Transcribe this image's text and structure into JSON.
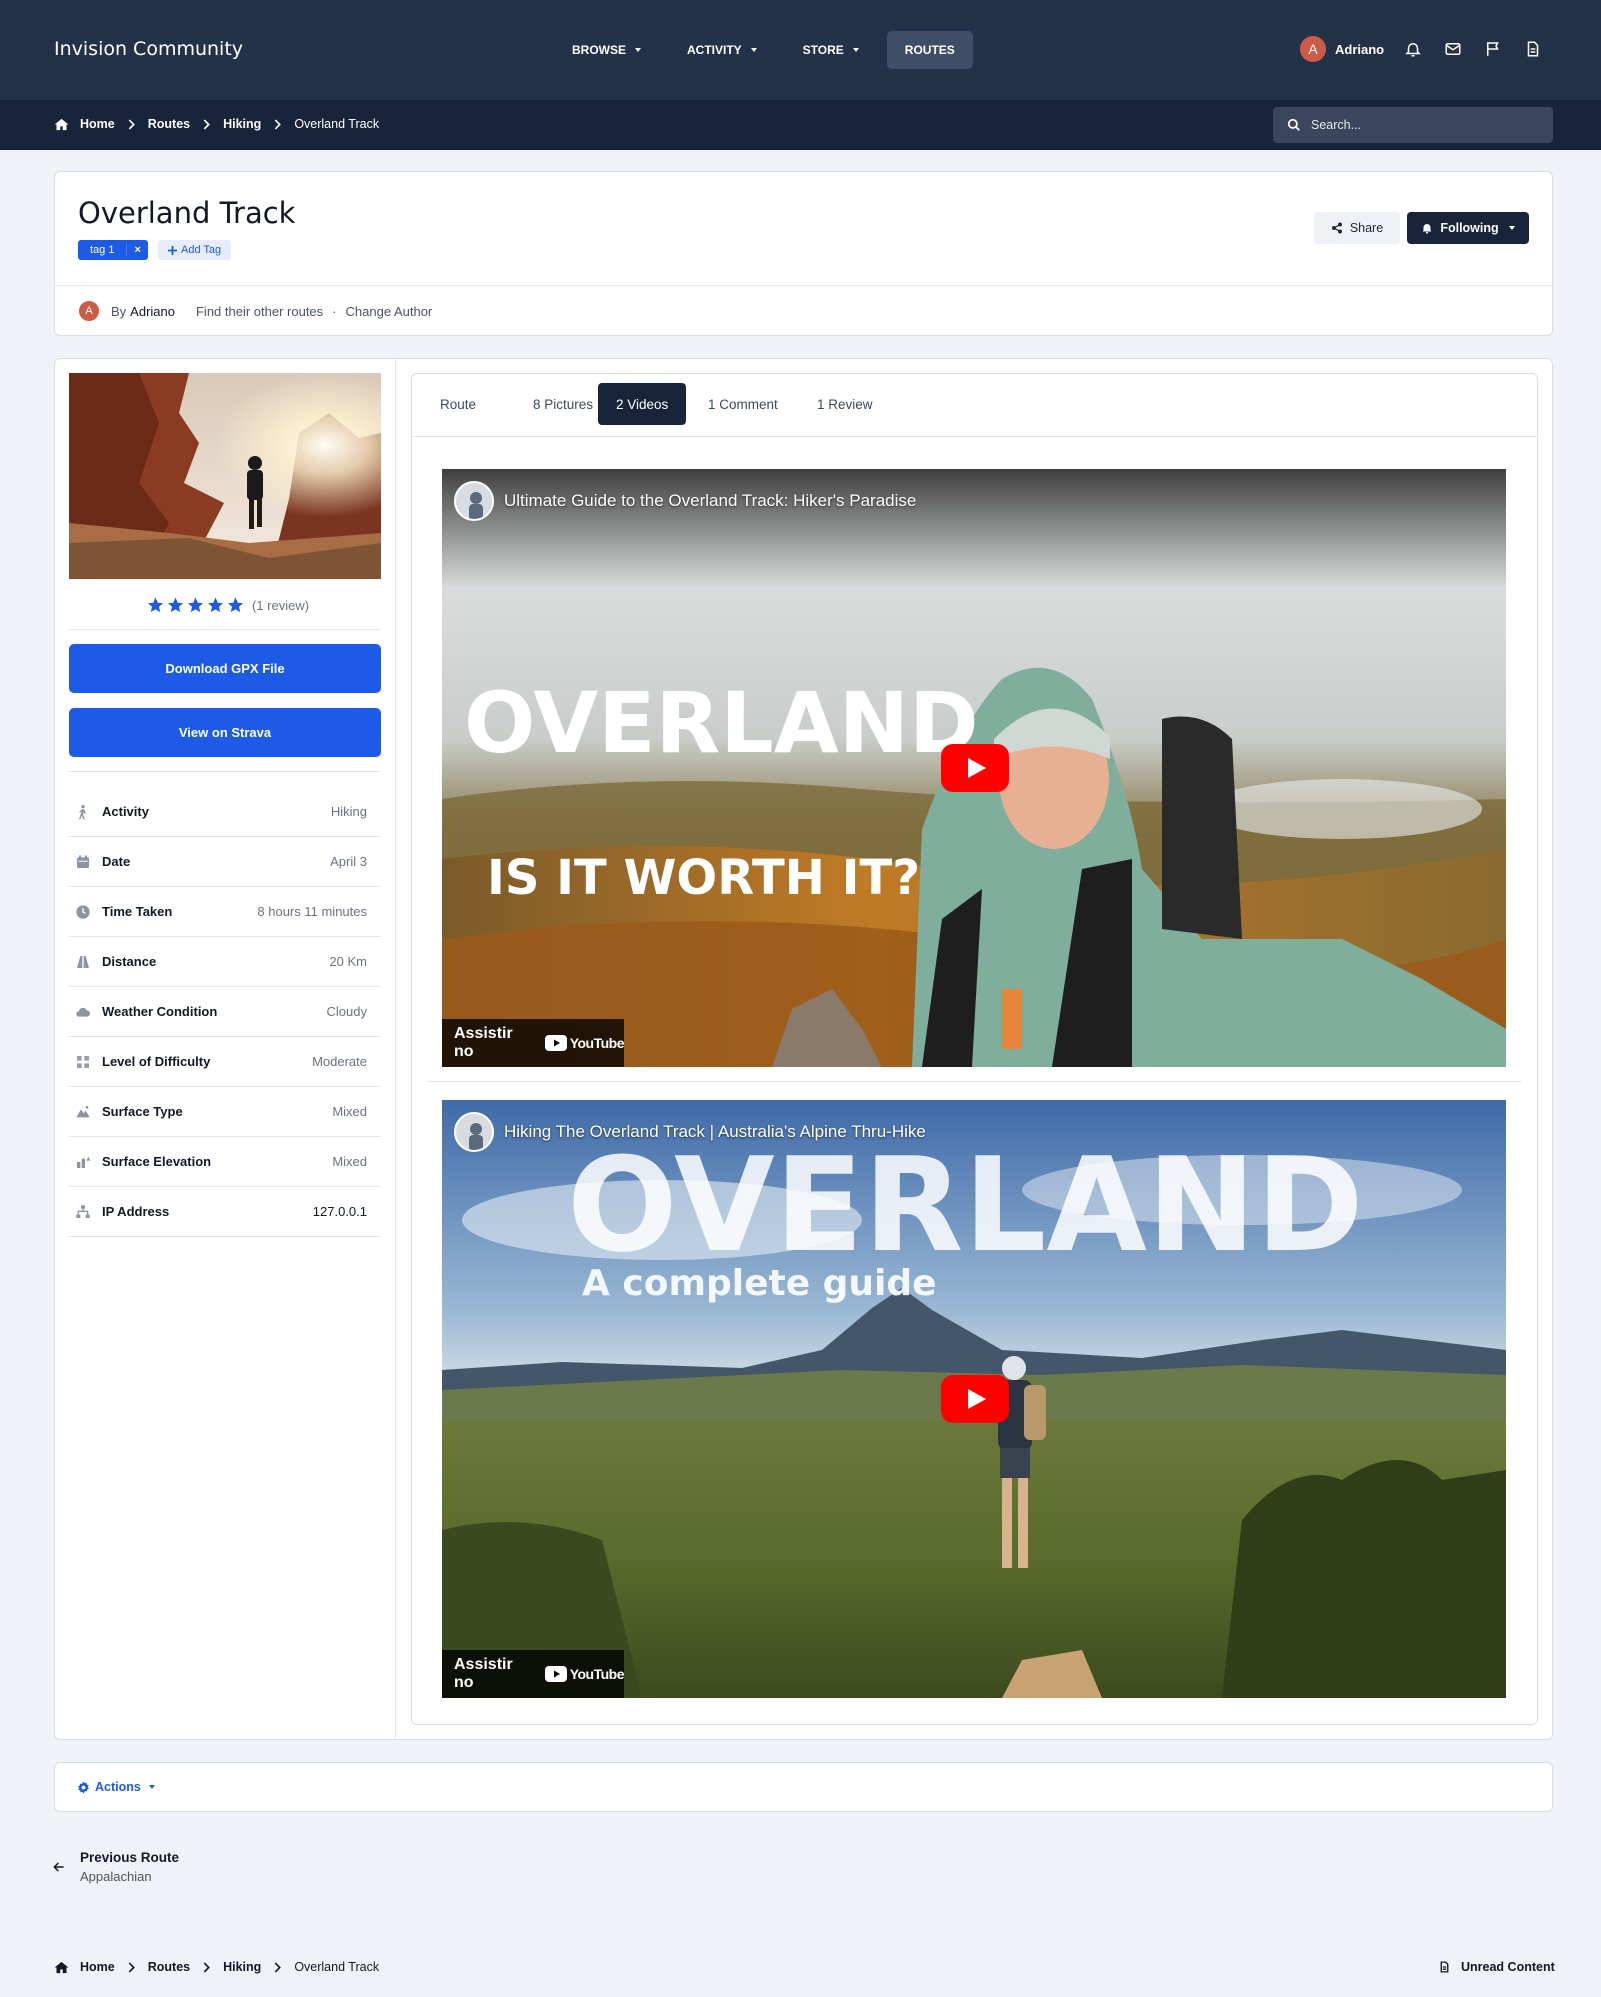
{
  "header": {
    "brand": "Invision Community",
    "nav": [
      {
        "label": "BROWSE",
        "dropdown": true
      },
      {
        "label": "ACTIVITY",
        "dropdown": true
      },
      {
        "label": "STORE",
        "dropdown": true
      },
      {
        "label": "ROUTES",
        "dropdown": false,
        "active": true
      }
    ],
    "user": {
      "initial": "A",
      "name": "Adriano"
    },
    "icons": [
      "bell-icon",
      "envelope-icon",
      "flag-icon",
      "document-icon"
    ]
  },
  "breadcrumb": {
    "items": [
      "Home",
      "Routes",
      "Hiking"
    ],
    "current": "Overland Track"
  },
  "search": {
    "placeholder": "Search..."
  },
  "page": {
    "title": "Overland Track",
    "tag": "tag 1",
    "tag_remove": "×",
    "add_tag": "Add Tag",
    "share": "Share",
    "following": "Following",
    "author_prefix": "By",
    "author": "Adriano",
    "author_initial": "A",
    "find_routes": "Find their other routes",
    "separator": "·",
    "change_author": "Change Author"
  },
  "sidebar": {
    "rating_stars": 5,
    "review_count": "(1 review)",
    "download_gpx": "Download GPX File",
    "view_strava": "View on Strava",
    "details": [
      {
        "icon": "hiker-icon",
        "label": "Activity",
        "value": "Hiking"
      },
      {
        "icon": "calendar-icon",
        "label": "Date",
        "value": "April 3"
      },
      {
        "icon": "clock-icon",
        "label": "Time Taken",
        "value": "8 hours 11 minutes"
      },
      {
        "icon": "road-icon",
        "label": "Distance",
        "value": "20 Km"
      },
      {
        "icon": "cloud-icon",
        "label": "Weather Condition",
        "value": "Cloudy"
      },
      {
        "icon": "difficulty-icon",
        "label": "Level of Difficulty",
        "value": "Moderate"
      },
      {
        "icon": "mountain-icon",
        "label": "Surface Type",
        "value": "Mixed"
      },
      {
        "icon": "elevation-icon",
        "label": "Surface Elevation",
        "value": "Mixed"
      },
      {
        "icon": "network-icon",
        "label": "IP Address",
        "value": "127.0.0.1"
      }
    ]
  },
  "tabs": [
    {
      "label": "Route",
      "active": false
    },
    {
      "label": "8 Pictures",
      "active": false
    },
    {
      "label": "2 Videos",
      "active": true
    },
    {
      "label": "1 Comment",
      "active": false
    },
    {
      "label": "1 Review",
      "active": false
    }
  ],
  "videos": [
    {
      "title": "Ultimate Guide to the Overland Track: Hiker's Paradise",
      "thumb_line1": "OVERLAND",
      "thumb_line2": "IS IT WORTH IT?",
      "watch_label": "Assistir no",
      "platform": "YouTube"
    },
    {
      "title": "Hiking The Overland Track | Australia's Alpine Thru-Hike",
      "thumb_line1": "OVERLAND",
      "thumb_line2": "A complete guide",
      "watch_label": "Assistir no",
      "platform": "YouTube"
    }
  ],
  "actions": {
    "label": "Actions"
  },
  "previous": {
    "label": "Previous Route",
    "name": "Appalachian"
  },
  "footer": {
    "unread": "Unread Content"
  },
  "colors": {
    "header_bg": "#243249",
    "crumb_bg": "#17243a",
    "accent": "#1d5be6",
    "page_bg": "#eff2f7"
  }
}
